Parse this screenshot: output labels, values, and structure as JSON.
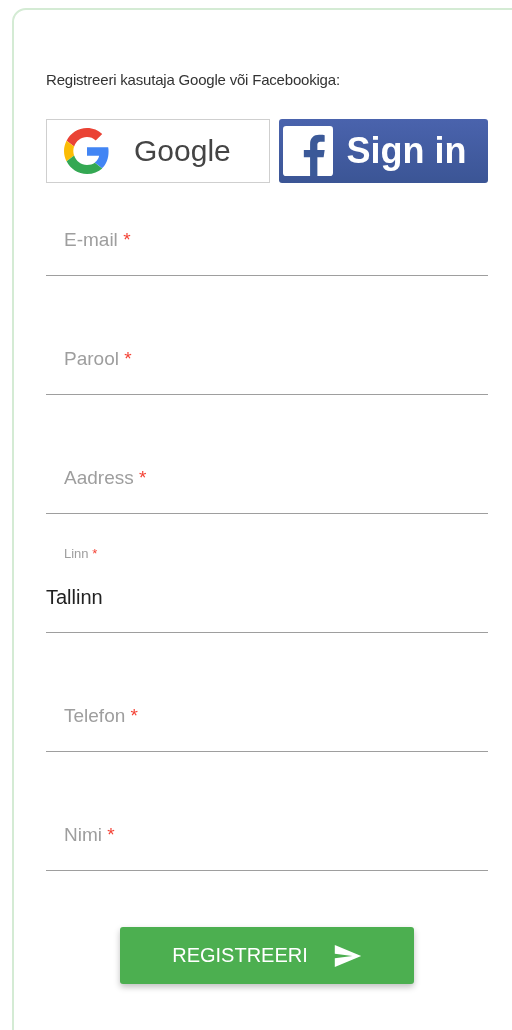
{
  "intro": "Registreeri kasutaja Google või Facebookiga:",
  "social_buttons": [
    {
      "kind": "google",
      "label": "Google"
    },
    {
      "kind": "facebook",
      "label": "Sign in"
    }
  ],
  "fields": [
    {
      "label": "E-mail",
      "required_mark": "*"
    },
    {
      "label": "Parool",
      "required_mark": "*"
    },
    {
      "label": "Aadress",
      "required_mark": "*"
    },
    {
      "label": "Linn",
      "required_mark": "*",
      "value": "Tallinn"
    },
    {
      "label": "Telefon",
      "required_mark": "*"
    },
    {
      "label": "Nimi",
      "required_mark": "*"
    }
  ],
  "submit_button": {
    "label": "REGISTREERI"
  }
}
